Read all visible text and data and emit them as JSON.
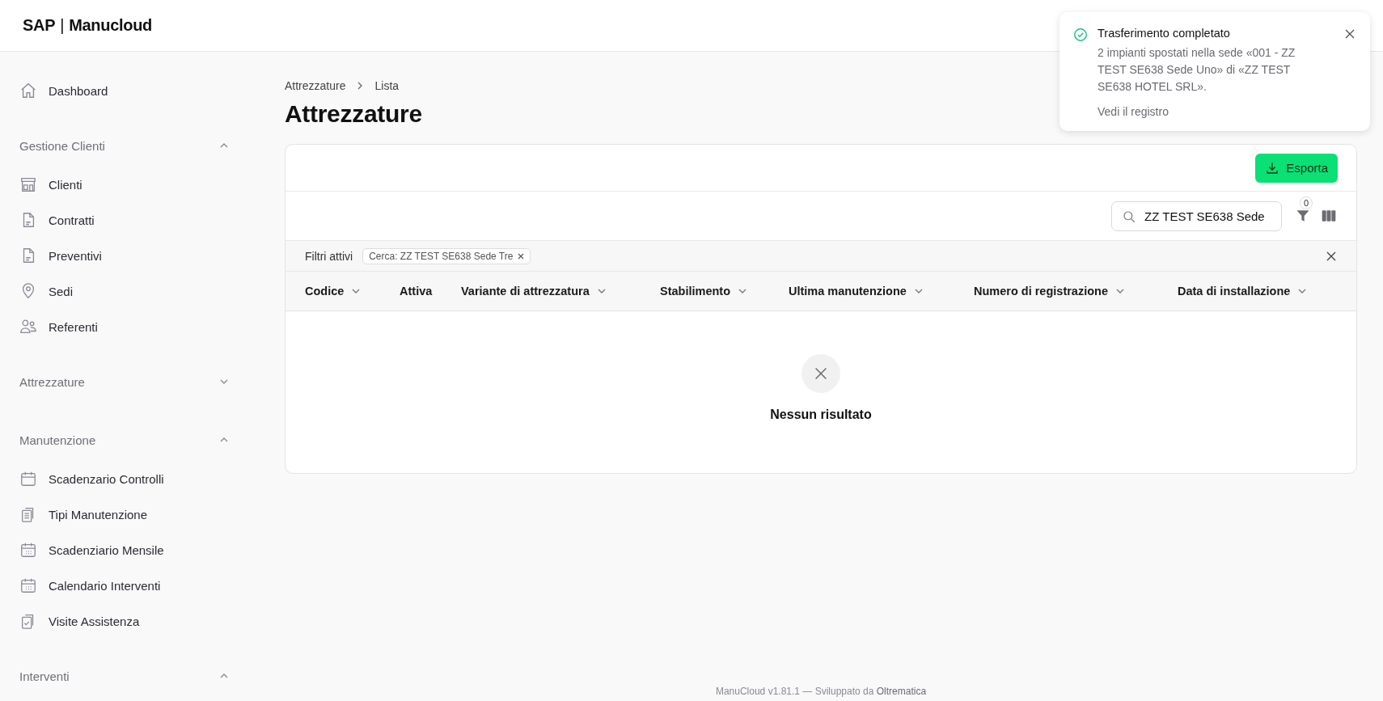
{
  "app": {
    "logo_brand": "SAP",
    "logo_separator": "|",
    "logo_name": "Manucloud"
  },
  "sidebar": {
    "top_items": [
      {
        "label": "Dashboard",
        "selected": false
      }
    ],
    "sections": [
      {
        "title": "Gestione Clienti",
        "expanded": true,
        "items": [
          {
            "label": "Clienti",
            "selected": false
          },
          {
            "label": "Contratti",
            "selected": false
          },
          {
            "label": "Preventivi",
            "selected": false
          },
          {
            "label": "Sedi",
            "selected": false
          },
          {
            "label": "Referenti",
            "selected": false
          }
        ]
      },
      {
        "title": "Attrezzature",
        "expanded": false
      },
      {
        "title": "Manutenzione",
        "expanded": true,
        "items": [
          {
            "label": "Scadenzario Controlli",
            "selected": false
          },
          {
            "label": "Tipi Manutenzione",
            "selected": false
          },
          {
            "label": "Scadenziario Mensile",
            "selected": false
          },
          {
            "label": "Calendario Interventi",
            "selected": false
          },
          {
            "label": "Visite Assistenza",
            "selected": false
          }
        ]
      },
      {
        "title": "Interventi",
        "expanded": true
      }
    ]
  },
  "breadcrumb": [
    "Attrezzature",
    "Lista"
  ],
  "page_title": "Attrezzature",
  "toolbar": {
    "export_button": "Esporta",
    "search": {
      "value": "ZZ TEST SE638 Sede"
    },
    "filter_count": "0"
  },
  "active_filters": {
    "label": "Filtri attivi",
    "chips": [
      {
        "text": "Cerca: ZZ TEST SE638 Sede Tre"
      }
    ]
  },
  "table": {
    "columns": [
      {
        "label": "Codice",
        "sortable": true
      },
      {
        "label": "Attiva",
        "sortable": false
      },
      {
        "label": "Variante di attrezzatura",
        "sortable": true
      },
      {
        "label": "Stabilimento",
        "sortable": true
      },
      {
        "label": "Ultima manutenzione",
        "sortable": true
      },
      {
        "label": "Numero di registrazione",
        "sortable": true
      },
      {
        "label": "Data di installazione",
        "sortable": true
      }
    ],
    "empty_message": "Nessun risultato"
  },
  "footer": {
    "text": "ManuCloud v1.81.1 — Sviluppato da ",
    "link": "Oltrematica"
  },
  "toast": {
    "title": "Trasferimento completato",
    "message": "2 impianti spostati nella sede «001 - ZZ TEST SE638 Sede Uno» di «ZZ TEST SE638 HOTEL SRL».",
    "link": "Vedi il registro"
  }
}
